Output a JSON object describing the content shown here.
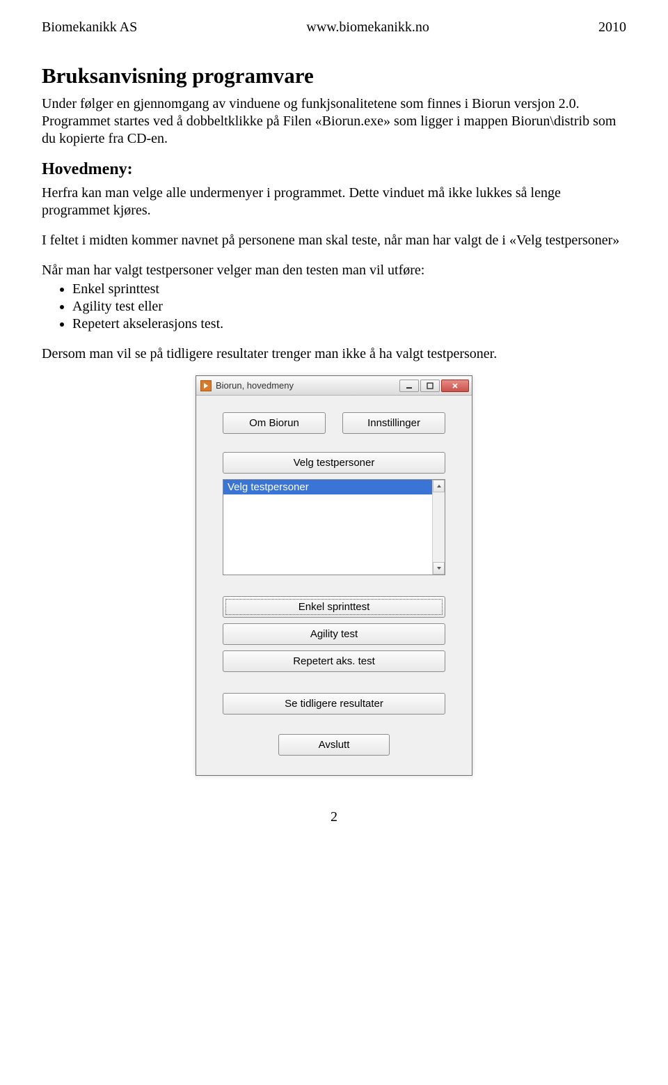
{
  "header": {
    "left": "Biomekanikk AS",
    "center": "www.biomekanikk.no",
    "right": "2010"
  },
  "title": "Bruksanvisning programvare",
  "intro": "Under følger en gjennomgang av vinduene og funkjsonalitetene som finnes i Biorun versjon 2.0. Programmet startes ved å dobbeltklikke på Filen «Biorun.exe» som ligger i mappen Biorun\\distrib som du kopierte fra CD-en.",
  "section_title": "Hovedmeny:",
  "para2": "Herfra kan man velge alle undermenyer i programmet. Dette vinduet må ikke lukkes så lenge programmet kjøres.",
  "para3": "I feltet i midten kommer navnet på personene man skal teste, når man har valgt de i «Velg testpersoner»",
  "para4": "Når man har valgt testpersoner velger man den testen man vil utføre:",
  "bullets": [
    "Enkel sprinttest",
    "Agility test eller",
    "Repetert akselerasjons test."
  ],
  "para5": "Dersom man vil se på tidligere resultater trenger man ikke å ha valgt testpersoner.",
  "dialog": {
    "window_title": "Biorun, hovedmeny",
    "top_buttons": {
      "about": "Om Biorun",
      "settings": "Innstillinger"
    },
    "select_testers": "Velg testpersoner",
    "listbox": {
      "items": [
        "Velg testpersoner"
      ],
      "selected_index": 0
    },
    "test_buttons": [
      "Enkel sprinttest",
      "Agility test",
      "Repetert aks. test"
    ],
    "prev_results": "Se tidligere resultater",
    "quit": "Avslutt"
  },
  "page_number": "2"
}
